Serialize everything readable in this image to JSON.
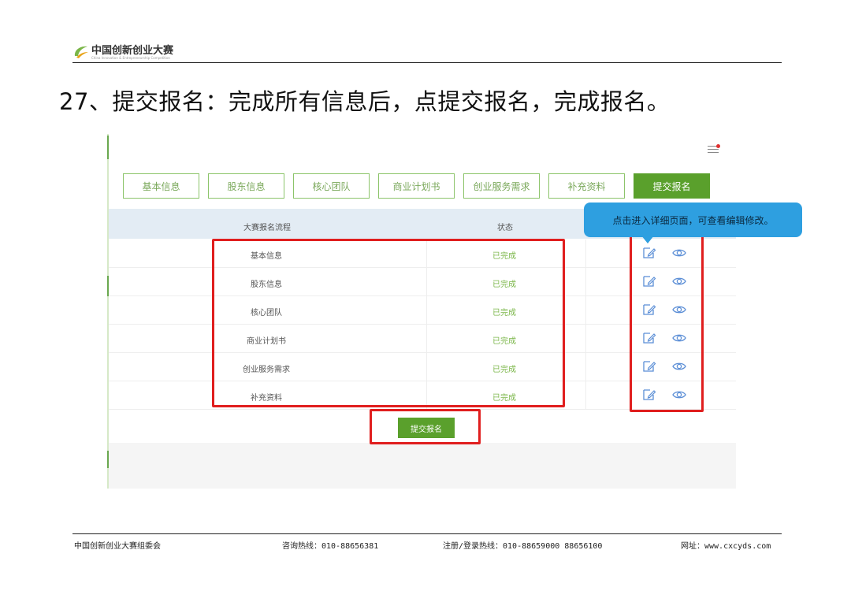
{
  "header": {
    "logo_text": "中国创新创业大赛",
    "logo_sub": "China Innovation & Entrepreneurship Competition"
  },
  "slide_title": "27、提交报名：完成所有信息后，点提交报名，完成报名。",
  "app": {
    "tabs": [
      {
        "label": "基本信息",
        "active": false
      },
      {
        "label": "股东信息",
        "active": false
      },
      {
        "label": "核心团队",
        "active": false
      },
      {
        "label": "商业计划书",
        "active": false
      },
      {
        "label": "创业服务需求",
        "active": false
      },
      {
        "label": "补充资料",
        "active": false
      },
      {
        "label": "提交报名",
        "active": true
      }
    ],
    "table": {
      "headers": [
        "大赛报名流程",
        "状态"
      ],
      "rows": [
        {
          "name": "基本信息",
          "status": "已完成"
        },
        {
          "name": "股东信息",
          "status": "已完成"
        },
        {
          "name": "核心团队",
          "status": "已完成"
        },
        {
          "name": "商业计划书",
          "status": "已完成"
        },
        {
          "name": "创业服务需求",
          "status": "已完成"
        },
        {
          "name": "补充资料",
          "status": "已完成"
        }
      ]
    },
    "submit_label": "提交报名",
    "tooltip": "点击进入详细页面，可查看编辑修改。",
    "colors": {
      "accent_green": "#5aa02c",
      "status_green": "#7ab648",
      "highlight_red": "#e01e1e",
      "tooltip_blue": "#2e9fe0"
    }
  },
  "footer": {
    "org": "中国创新创业大赛组委会",
    "hotline": "咨询热线：010-88656381",
    "register": "注册/登录热线：010-88659000  88656100",
    "website": "网址：www.cxcyds.com"
  }
}
